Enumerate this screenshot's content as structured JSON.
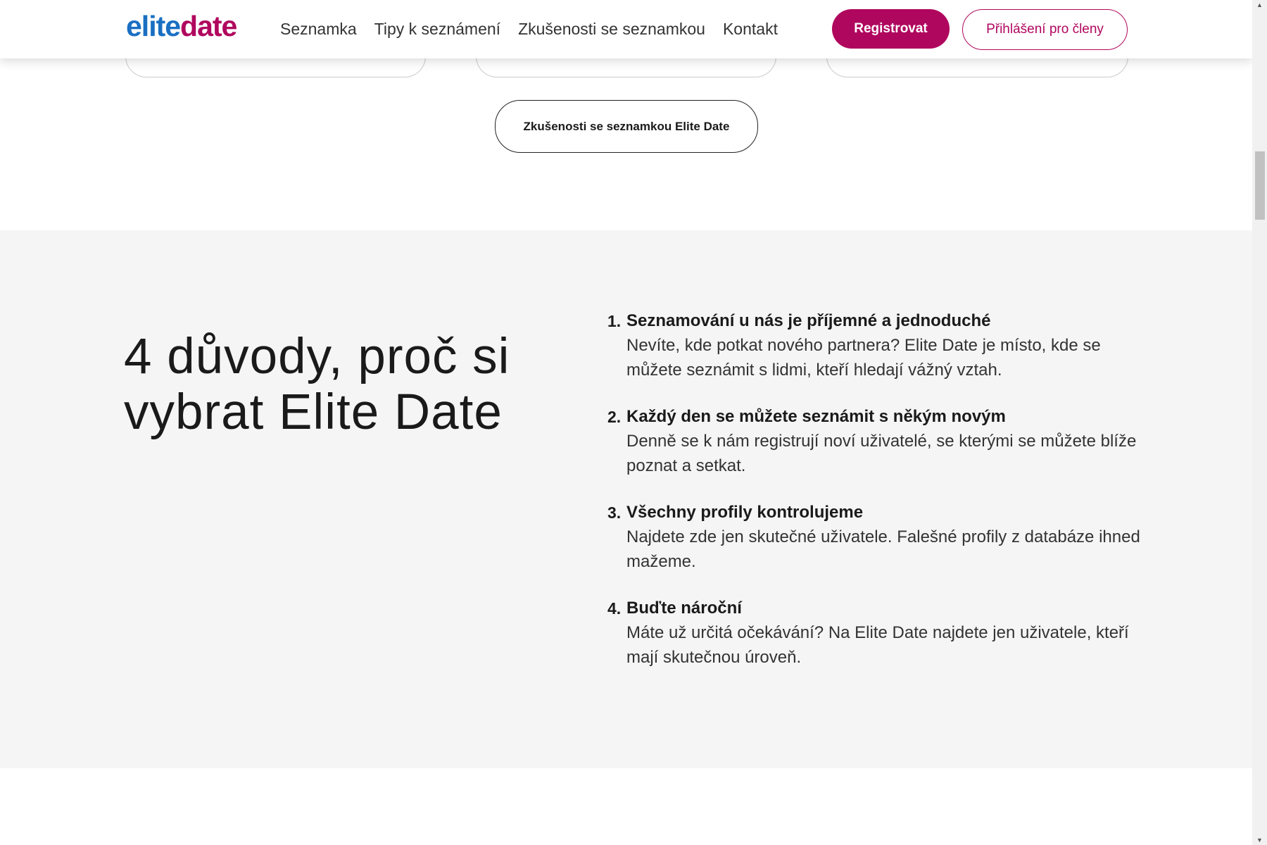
{
  "header": {
    "logo_part1": "elite",
    "logo_part2": "date",
    "nav": [
      "Seznamka",
      "Tipy k seznámení",
      "Zkušenosti se seznamkou",
      "Kontakt"
    ],
    "register": "Registrovat",
    "login": "Přihlášení pro členy"
  },
  "experience_button": "Zkušenosti se seznamkou Elite Date",
  "reasons": {
    "heading_line1": "4 důvody, proč si",
    "heading_line2": "vybrat Elite Date",
    "items": [
      {
        "num": "1.",
        "title": "Seznamování u nás je příjemné a jednoduché",
        "text": "Nevíte, kde potkat nového partnera? Elite Date je místo, kde se můžete seznámit s lidmi, kteří hledají vážný vztah."
      },
      {
        "num": "2.",
        "title": "Každý den se můžete seznámit s někým novým",
        "text": "Denně se k nám registrují noví uživatelé, se kterými se můžete blíže poznat a setkat."
      },
      {
        "num": "3.",
        "title": "Všechny profily kontrolujeme",
        "text": "Najdete zde jen skutečné uživatele. Falešné profily z databáze ihned mažeme."
      },
      {
        "num": "4.",
        "title": "Buďte nároční",
        "text": "Máte už určitá očekávání? Na Elite Date najdete jen uživatele, kteří mají skutečnou úroveň."
      }
    ]
  }
}
